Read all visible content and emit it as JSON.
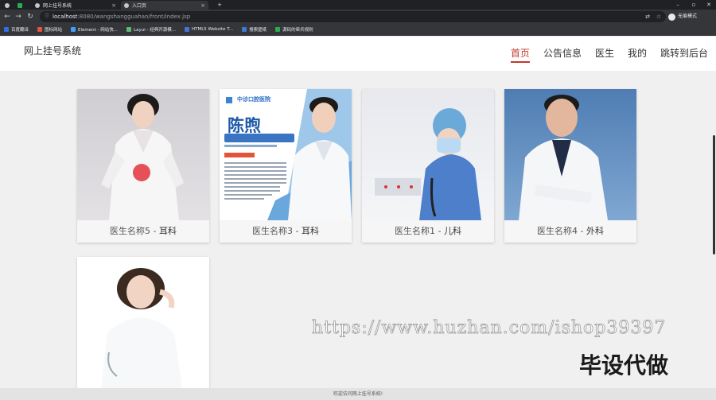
{
  "browser": {
    "tabs": [
      {
        "label": ""
      },
      {
        "label": "网上挂号系统"
      },
      {
        "label": "入口页"
      }
    ],
    "new_tab": "+",
    "url_host": "localhost",
    "url_rest": ":8080/wangshangguahan/front/index.jsp",
    "profile_label": "无痕模式",
    "bookmarks": [
      {
        "label": "百度翻译",
        "color": "#2f6fe4"
      },
      {
        "label": "图标网站",
        "color": "#e5533d"
      },
      {
        "label": "Element - 网站快...",
        "color": "#409eff"
      },
      {
        "label": "Layui - 经典开源模...",
        "color": "#5fb878"
      },
      {
        "label": "HTML5 Website T...",
        "color": "#4a72d6"
      },
      {
        "label": "搜索壁纸",
        "color": "#3a7bd5"
      },
      {
        "label": "源码的牵兵规则",
        "color": "#2eaa4f"
      }
    ]
  },
  "header": {
    "brand": "网上挂号系统",
    "nav": [
      {
        "label": "首页",
        "active": true
      },
      {
        "label": "公告信息",
        "active": false
      },
      {
        "label": "医生",
        "active": false
      },
      {
        "label": "我的",
        "active": false
      },
      {
        "label": "跳转到后台",
        "active": false
      }
    ],
    "accent_color": "#c0392b"
  },
  "doctors": [
    {
      "name": "医生名称5",
      "sep": " - ",
      "dept": "耳科"
    },
    {
      "name": "医生名称3",
      "sep": " - ",
      "dept": "耳科",
      "poster_name": "陈煦",
      "poster_org": "中诊口腔医院"
    },
    {
      "name": "医生名称1",
      "sep": " - ",
      "dept": "儿科"
    },
    {
      "name": "医生名称4",
      "sep": " - ",
      "dept": "外科"
    },
    {
      "name": "",
      "sep": "",
      "dept": ""
    }
  ],
  "watermark": {
    "url": "https://www.huzhan.com/ishop39397",
    "text": "毕设代做"
  },
  "footer": {
    "text": "欢迎访问网上挂号系统!"
  }
}
